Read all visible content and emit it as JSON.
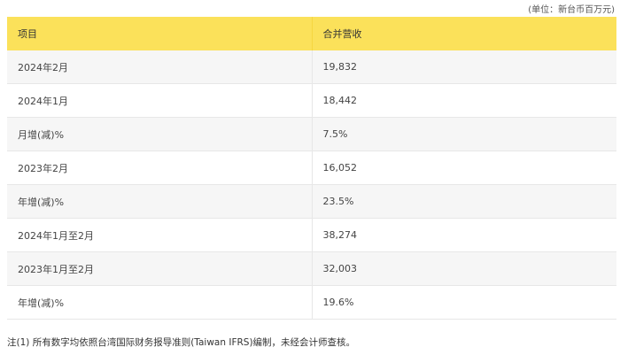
{
  "unit_note": "(单位：新台币百万元)",
  "table": {
    "headers": [
      "项目",
      "合并营收"
    ],
    "rows": [
      {
        "item": "2024年2月",
        "value": "19,832"
      },
      {
        "item": "2024年1月",
        "value": "18,442"
      },
      {
        "item": "月增(减)%",
        "value": "7.5%"
      },
      {
        "item": "2023年2月",
        "value": "16,052"
      },
      {
        "item": "年增(减)%",
        "value": "23.5%"
      },
      {
        "item": "2024年1月至2月",
        "value": "38,274"
      },
      {
        "item": "2023年1月至2月",
        "value": "32,003"
      },
      {
        "item": "年增(减)%",
        "value": "19.6%"
      }
    ]
  },
  "footnote": "注(1) 所有数字均依照台湾国际财务报导准则(Taiwan IFRS)编制，未经会计师查核。",
  "colors": {
    "header_bg": "#fbe15a",
    "row_alt_bg": "#f6f6f6",
    "divider": "#e7e7e7"
  }
}
